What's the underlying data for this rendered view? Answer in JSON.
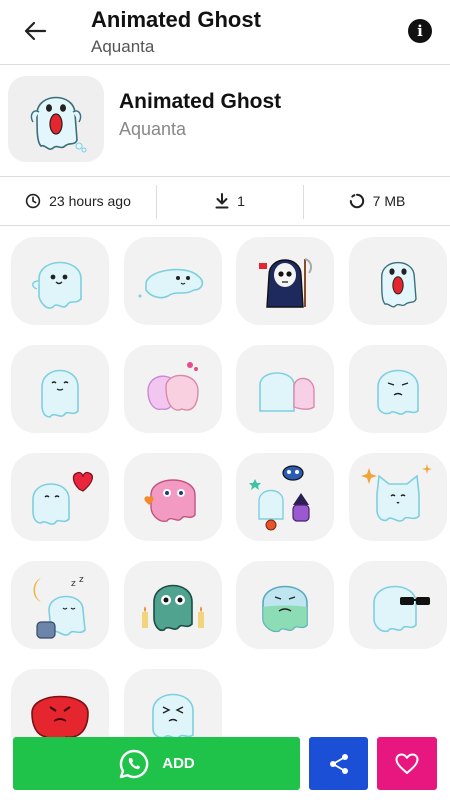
{
  "appbar": {
    "title": "Animated Ghost",
    "subtitle": "Aquanta",
    "back_icon": "arrow-left-icon",
    "info_icon": "info-icon",
    "info_glyph": "i"
  },
  "pack": {
    "title": "Animated Ghost",
    "author": "Aquanta",
    "thumbnail": "screaming-ghost-sticker"
  },
  "stats": {
    "updated": "23 hours ago",
    "downloads": "1",
    "size": "7 MB",
    "updated_icon": "clock-icon",
    "downloads_icon": "download-icon",
    "size_icon": "loading-circle-icon"
  },
  "stickers": [
    {
      "name": "ghost-smiling"
    },
    {
      "name": "ghost-lying-down"
    },
    {
      "name": "ghost-grim-reaper"
    },
    {
      "name": "ghost-screaming"
    },
    {
      "name": "ghost-shy"
    },
    {
      "name": "ghost-pink-hug"
    },
    {
      "name": "ghost-peeking"
    },
    {
      "name": "ghost-grumpy"
    },
    {
      "name": "ghost-heart"
    },
    {
      "name": "ghost-pink-blush"
    },
    {
      "name": "ghost-halloween-party"
    },
    {
      "name": "ghost-cat-sparkles"
    },
    {
      "name": "ghost-sleeping-moon"
    },
    {
      "name": "ghost-candles"
    },
    {
      "name": "ghost-sick"
    },
    {
      "name": "ghost-sunglasses"
    },
    {
      "name": "ghost-red-angry"
    },
    {
      "name": "ghost-squinting"
    }
  ],
  "actions": {
    "add_label": "ADD",
    "add_icon": "whatsapp-icon",
    "share_icon": "share-icon",
    "favorite_icon": "heart-icon"
  },
  "colors": {
    "add": "#20c34a",
    "share": "#1a4fd6",
    "favorite": "#e8177f",
    "ghost_body": "#dff5fa",
    "ghost_outline": "#7ecfe0"
  }
}
